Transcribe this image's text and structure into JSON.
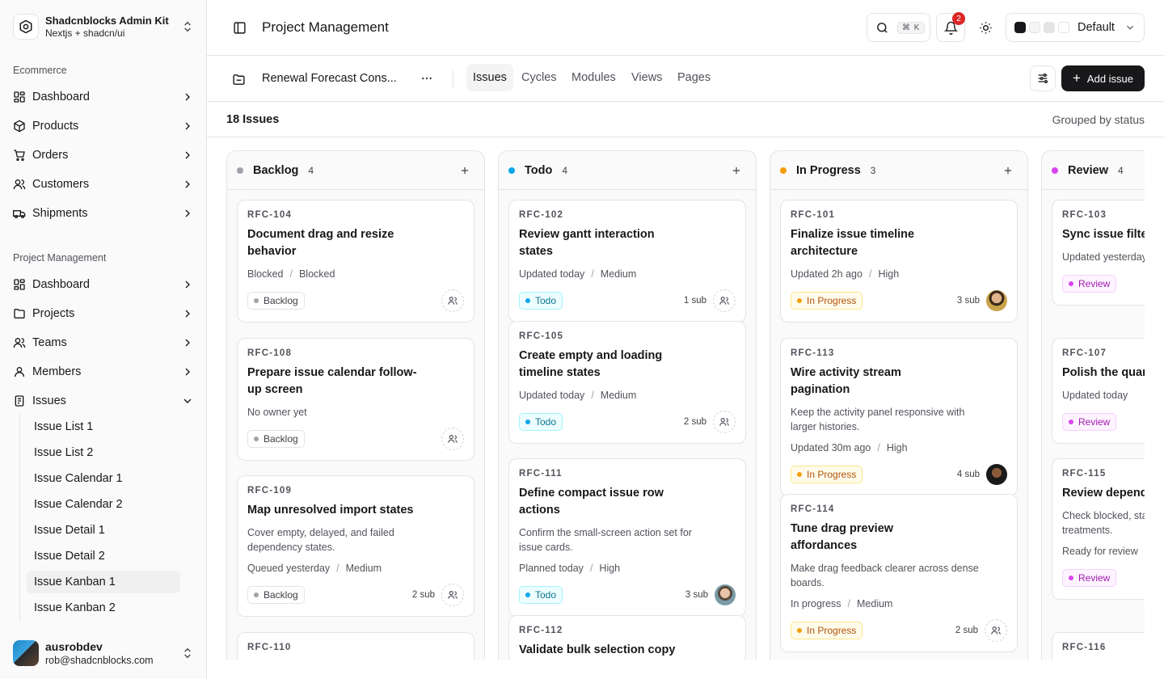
{
  "sidebar": {
    "brand": {
      "title": "Shadcnblocks Admin Kit",
      "subtitle": "Nextjs + shadcn/ui"
    },
    "groups": [
      {
        "label": "Ecommerce",
        "items": [
          "Dashboard",
          "Products",
          "Orders",
          "Customers",
          "Shipments"
        ]
      },
      {
        "label": "Project Management",
        "items": [
          "Dashboard",
          "Projects",
          "Teams",
          "Members",
          "Issues"
        ]
      }
    ],
    "issues_sub": [
      "Issue List 1",
      "Issue List 2",
      "Issue Calendar 1",
      "Issue Calendar 2",
      "Issue Detail 1",
      "Issue Detail 2",
      "Issue Kanban 1",
      "Issue Kanban 2"
    ],
    "active_sub": "Issue Kanban 1",
    "user": {
      "name": "ausrobdev",
      "email": "rob@shadcnblocks.com"
    }
  },
  "topbar": {
    "title": "Project Management",
    "search_kbd": "⌘ K",
    "notifications": "2",
    "theme": "Default",
    "swatches": [
      "#18181b",
      "#f4f4f5",
      "#e4e4e7",
      "#ffffff"
    ]
  },
  "project": {
    "name": "Renewal Forecast Cons...",
    "tabs": [
      "Issues",
      "Cycles",
      "Modules",
      "Views",
      "Pages"
    ],
    "active_tab": "Issues",
    "add_label": "Add issue"
  },
  "summary": {
    "count": "18 Issues",
    "grouped": "Grouped by status"
  },
  "columns": [
    {
      "name": "Backlog",
      "count": "4",
      "color": "#a1a1aa",
      "cards": [
        {
          "key": "RFC-104",
          "title": "Document drag and resize behavior",
          "desc": "",
          "meta": [
            "Blocked",
            "Blocked"
          ],
          "status": "Backlog",
          "sub": "",
          "assignee": "none"
        },
        {
          "key": "RFC-108",
          "title": "Prepare issue calendar follow-up screen",
          "desc": "",
          "meta": [
            "No owner yet"
          ],
          "status": "Backlog",
          "sub": "",
          "assignee": "none"
        },
        {
          "key": "RFC-109",
          "title": "Map unresolved import states",
          "desc": "Cover empty, delayed, and failed dependency states.",
          "meta": [
            "Queued yesterday",
            "Medium"
          ],
          "status": "Backlog",
          "sub": "2 sub",
          "assignee": "none"
        },
        {
          "key": "RFC-110",
          "title": "",
          "desc": "",
          "meta": [],
          "status": "",
          "sub": "",
          "assignee": "none"
        }
      ]
    },
    {
      "name": "Todo",
      "count": "4",
      "color": "#0ea5e9",
      "cards": [
        {
          "key": "RFC-102",
          "title": "Review gantt interaction states",
          "desc": "",
          "meta": [
            "Updated today",
            "Medium"
          ],
          "status": "Todo",
          "sub": "1 sub",
          "assignee": "none"
        },
        {
          "key": "RFC-105",
          "title": "Create empty and loading timeline states",
          "desc": "",
          "meta": [
            "Updated today",
            "Medium"
          ],
          "status": "Todo",
          "sub": "2 sub",
          "assignee": "none"
        },
        {
          "key": "RFC-111",
          "title": "Define compact issue row actions",
          "desc": "Confirm the small-screen action set for issue cards.",
          "meta": [
            "Planned today",
            "High"
          ],
          "status": "Todo",
          "sub": "3 sub",
          "assignee": "f3"
        },
        {
          "key": "RFC-112",
          "title": "Validate bulk selection copy",
          "desc": "",
          "meta": [],
          "status": "",
          "sub": "",
          "assignee": "none"
        }
      ]
    },
    {
      "name": "In Progress",
      "count": "3",
      "color": "#f59e0b",
      "cards": [
        {
          "key": "RFC-101",
          "title": "Finalize issue timeline architecture",
          "desc": "",
          "meta": [
            "Updated 2h ago",
            "High"
          ],
          "status": "In Progress",
          "sub": "3 sub",
          "assignee": "f1"
        },
        {
          "key": "RFC-113",
          "title": "Wire activity stream pagination",
          "desc": "Keep the activity panel responsive with larger histories.",
          "meta": [
            "Updated 30m ago",
            "High"
          ],
          "status": "In Progress",
          "sub": "4 sub",
          "assignee": "f2"
        },
        {
          "key": "RFC-114",
          "title": "Tune drag preview affordances",
          "desc": "Make drag feedback clearer across dense boards.",
          "meta": [
            "In progress",
            "Medium"
          ],
          "status": "In Progress",
          "sub": "2 sub",
          "assignee": "none"
        }
      ]
    },
    {
      "name": "Review",
      "count": "4",
      "color": "#d946ef",
      "cards": [
        {
          "key": "RFC-103",
          "title": "Sync issue filter views",
          "desc": "",
          "meta": [
            "Updated yesterday"
          ],
          "status": "Review",
          "sub": "",
          "assignee": "none"
        },
        {
          "key": "RFC-107",
          "title": "Polish the quarterly",
          "desc": "",
          "meta": [
            "Updated today"
          ],
          "status": "Review",
          "sub": "",
          "assignee": "none"
        },
        {
          "key": "RFC-115",
          "title": "Review dependency variants",
          "desc": "Check blocked, stale dependency treatments.",
          "meta": [
            "Ready for review"
          ],
          "status": "Review",
          "sub": "",
          "assignee": "none"
        },
        {
          "key": "RFC-116",
          "title": "",
          "desc": "",
          "meta": [],
          "status": "",
          "sub": "",
          "assignee": "none"
        }
      ]
    }
  ],
  "badge_styles": {
    "Backlog": {
      "bg": "#ffffff",
      "fg": "#3f3f46",
      "border": "#e4e4e7",
      "dot": "#a1a1aa"
    },
    "Todo": {
      "bg": "#ecfeff",
      "fg": "#0e7490",
      "border": "#a5f3fc",
      "dot": "#0ea5e9"
    },
    "In Progress": {
      "bg": "#fffbeb",
      "fg": "#b45309",
      "border": "#fde68a",
      "dot": "#f59e0b"
    },
    "Review": {
      "bg": "#fdf4ff",
      "fg": "#a21caf",
      "border": "#f5d0fe",
      "dot": "#d946ef"
    }
  }
}
